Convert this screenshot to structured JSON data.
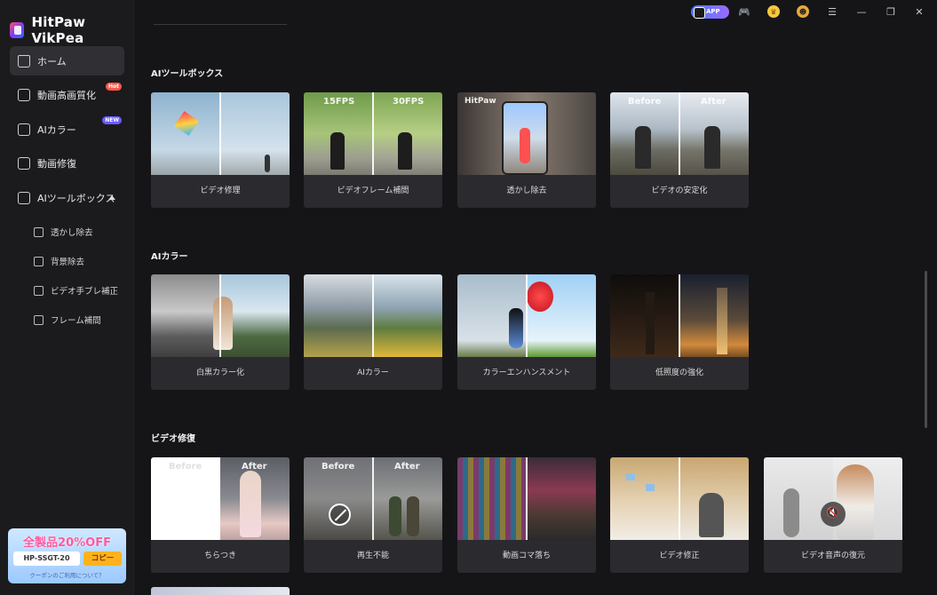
{
  "app": {
    "name": "HitPaw VikPea"
  },
  "titlebar": {
    "app_badge": "APP",
    "coin_icon": "coin-icon",
    "avatar_icon": "user-crown-icon"
  },
  "sidebar": {
    "items": [
      {
        "label": "ホーム",
        "icon": "home-icon",
        "active": true
      },
      {
        "label": "動画高画質化",
        "icon": "video-enhance-icon",
        "badge": "Hot"
      },
      {
        "label": "AIカラー",
        "icon": "ai-color-icon",
        "badge": "NEW"
      },
      {
        "label": "動画修復",
        "icon": "video-repair-icon"
      },
      {
        "label": "AIツールボックス",
        "icon": "toolbox-icon",
        "expanded": true
      }
    ],
    "subitems": [
      {
        "label": "透かし除去",
        "icon": "eraser-icon"
      },
      {
        "label": "背景除去",
        "icon": "background-remove-icon"
      },
      {
        "label": "ビデオ手ブレ補正",
        "icon": "stabilize-icon"
      },
      {
        "label": "フレーム補間",
        "icon": "frame-interp-icon"
      }
    ]
  },
  "promo": {
    "title": "全製品20%OFF",
    "code": "HP-SSGT-20",
    "copy": "コピー",
    "note": "クーポンのご利用について？"
  },
  "sections": [
    {
      "title": "AIツールボックス",
      "cards": [
        {
          "label": "ビデオ修理",
          "tag_left": "",
          "tag_right": ""
        },
        {
          "label": "ビデオフレーム補間",
          "tag_left": "15FPS",
          "tag_right": "30FPS"
        },
        {
          "label": "透かし除去",
          "tag_left": "HitPaw",
          "tag_right": ""
        },
        {
          "label": "ビデオの安定化",
          "tag_left": "Before",
          "tag_right": "After"
        }
      ]
    },
    {
      "title": "AIカラー",
      "cards": [
        {
          "label": "白黒カラー化",
          "tag_left": "",
          "tag_right": ""
        },
        {
          "label": "AIカラー",
          "tag_left": "",
          "tag_right": ""
        },
        {
          "label": "カラーエンハンスメント",
          "tag_left": "",
          "tag_right": ""
        },
        {
          "label": "低照度の強化",
          "tag_left": "",
          "tag_right": ""
        }
      ]
    },
    {
      "title": "ビデオ修復",
      "cards": [
        {
          "label": "ちらつき",
          "tag_left": "Before",
          "tag_right": "After"
        },
        {
          "label": "再生不能",
          "tag_left": "Before",
          "tag_right": "After"
        },
        {
          "label": "動画コマ落ち",
          "tag_left": "",
          "tag_right": ""
        },
        {
          "label": "ビデオ修正",
          "tag_left": "",
          "tag_right": ""
        },
        {
          "label": "ビデオ音声の復元",
          "tag_left": "",
          "tag_right": ""
        }
      ]
    }
  ]
}
